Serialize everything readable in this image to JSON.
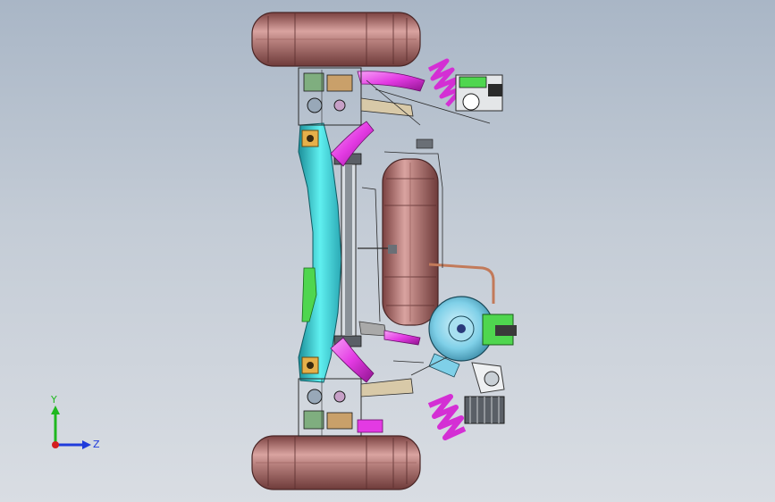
{
  "viewport": {
    "background_top": "#a9b6c6",
    "background_bottom": "#d9dde3"
  },
  "model": {
    "colors": {
      "tire": "#b47d7a",
      "tire_dark": "#6e3b3a",
      "frame": "#45e6e6",
      "frame_dark": "#1c8f9a",
      "pipe": "#e33ae3",
      "spring": "#d42fd4",
      "bracket": "#e6b04a",
      "hub": "#7fd0e8",
      "green": "#4fd64f",
      "line": "#2a2a2a"
    }
  },
  "triad": {
    "y_label": "Y",
    "z_label": "Z",
    "y_color": "#1fb81f",
    "z_color": "#1f3bdb",
    "x_color": "#d41f1f"
  }
}
